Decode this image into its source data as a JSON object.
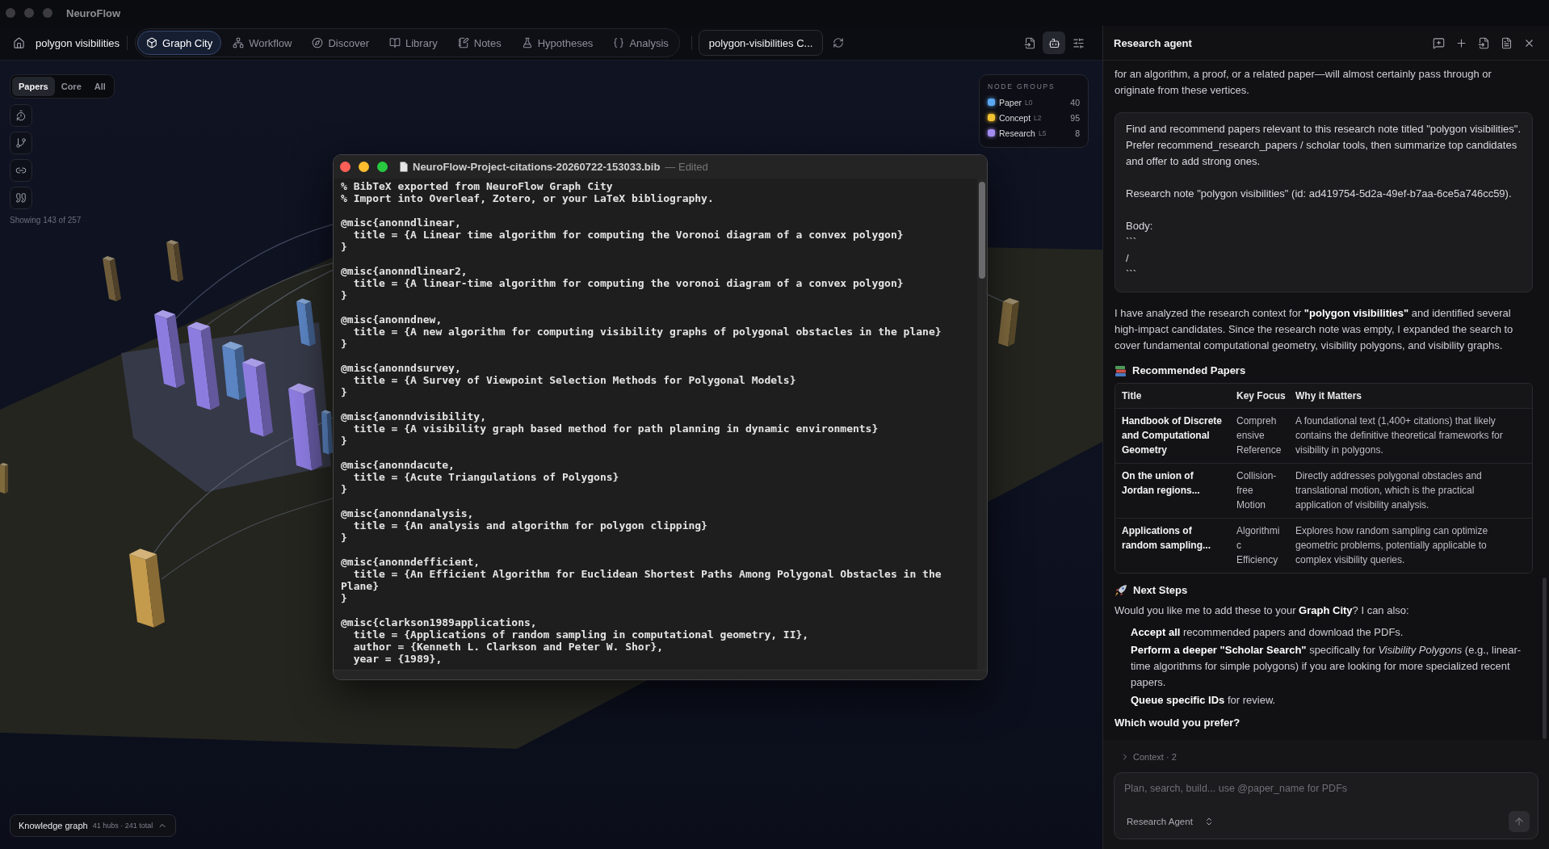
{
  "window": {
    "title": "NeuroFlow"
  },
  "toolbar": {
    "project": "polygon visibilities",
    "nav": [
      {
        "label": "Graph City",
        "selected": true
      },
      {
        "label": "Workflow",
        "selected": false
      },
      {
        "label": "Discover",
        "selected": false
      },
      {
        "label": "Library",
        "selected": false
      },
      {
        "label": "Notes",
        "selected": false
      },
      {
        "label": "Hypotheses",
        "selected": false
      },
      {
        "label": "Analysis",
        "selected": false
      }
    ],
    "document_tab": "polygon-visibilities C...",
    "actions": [
      {
        "selected": false
      },
      {
        "selected": true
      },
      {
        "selected": false
      }
    ]
  },
  "canvas": {
    "view_modes": [
      {
        "label": "Papers",
        "selected": true
      },
      {
        "label": "Core",
        "selected": false
      },
      {
        "label": "All",
        "selected": false
      }
    ],
    "showing": "Showing 143 of 257",
    "node_groups": {
      "title": "NODE GROUPS",
      "items": [
        {
          "label": "Paper",
          "tier": "L0",
          "count": "40",
          "color": "#5aa8f2"
        },
        {
          "label": "Concept",
          "tier": "L2",
          "count": "95",
          "color": "#f2c230"
        },
        {
          "label": "Research",
          "tier": "L5",
          "count": "8",
          "color": "#a48cf0"
        }
      ]
    },
    "footer": {
      "label": "Knowledge graph",
      "meta": "41 hubs · 241 total"
    }
  },
  "editor_window": {
    "title": "NeuroFlow-Project-citations-20260722-153033.bib",
    "status": "— Edited",
    "comments": [
      "% BibTeX exported from NeuroFlow Graph City",
      "% Import into Overleaf, Zotero, or your LaTeX bibliography."
    ],
    "entries": [
      {
        "lines": [
          "@misc{anonndlinear,",
          "  title = {A Linear time algorithm for computing the Voronoi diagram of a convex polygon}",
          "}"
        ]
      },
      {
        "lines": [
          "@misc{anonndlinear2,",
          "  title = {A linear-time algorithm for computing the voronoi diagram of a convex polygon}",
          "}"
        ]
      },
      {
        "lines": [
          "@misc{anonndnew,",
          "  title = {A new algorithm for computing visibility graphs of polygonal obstacles in the plane}",
          "}"
        ]
      },
      {
        "lines": [
          "@misc{anonndsurvey,",
          "  title = {A Survey of Viewpoint Selection Methods for Polygonal Models}",
          "}"
        ]
      },
      {
        "lines": [
          "@misc{anonndvisibility,",
          "  title = {A visibility graph based method for path planning in dynamic environments}",
          "}"
        ]
      },
      {
        "lines": [
          "@misc{anonndacute,",
          "  title = {Acute Triangulations of Polygons}",
          "}"
        ]
      },
      {
        "lines": [
          "@misc{anonndanalysis,",
          "  title = {An analysis and algorithm for polygon clipping}",
          "}"
        ]
      },
      {
        "lines": [
          "@misc{anonndefficient,",
          "  title = {An Efficient Algorithm for Euclidean Shortest Paths Among Polygonal Obstacles in the Plane}",
          "}"
        ]
      },
      {
        "lines": [
          "@misc{clarkson1989applications,",
          "  title = {Applications of random sampling in computational geometry, II},",
          "  author = {Kenneth L. Clarkson and Peter W. Shor},",
          "  year = {1989},"
        ]
      }
    ]
  },
  "agent_panel": {
    "title": "Research agent",
    "intro_tail": "for an algorithm, a proof, or a related paper—will almost certainly pass through or originate from these vertices.",
    "user_message": [
      "Find and recommend papers relevant to this research note titled \"polygon visibilities\". Prefer recommend_research_papers / scholar tools, then summarize top candidates and offer to add strong ones.",
      "Research note \"polygon visibilities\" (id: ad419754-5d2a-49ef-b7aa-6ce5a746cc59).",
      "Body:\n```\n/\n```"
    ],
    "summary": "I have analyzed the research context for **\"polygon visibilities\"** and identified several high-impact candidates. Since the research note was empty, I expanded the search to cover fundamental computational geometry, visibility polygons, and visibility graphs.",
    "papers_heading": "Recommended Papers",
    "table": {
      "columns": [
        "Title",
        "Key Focus",
        "Why it Matters"
      ],
      "rows": [
        [
          "Handbook of Discrete and Computational Geometry",
          "Comprehensive Reference",
          "A foundational text (1,400+ citations) that likely contains the definitive theoretical frameworks for visibility in polygons."
        ],
        [
          "On the union of Jordan regions...",
          "Collision-free Motion",
          "Directly addresses polygonal obstacles and translational motion, which is the practical application of visibility analysis."
        ],
        [
          "Applications of random sampling...",
          "Algorithmic Efficiency",
          "Explores how random sampling can optimize geometric problems, potentially applicable to complex visibility queries."
        ]
      ]
    },
    "next_heading": "Next Steps",
    "next_intro": "Would you like me to add these to your **Graph City**? I can also:",
    "options": [
      "**Accept all** recommended papers and download the PDFs.",
      "**Perform a deeper \"Scholar Search\"** specifically for *Visibility Polygons* (e.g., linear-time algorithms for simple polygons) if you are looking for more specialized recent papers.",
      "**Queue specific IDs** for review."
    ],
    "question": "Which would you prefer?",
    "context": {
      "label": "Context · 2",
      "expanded": false
    },
    "composer": {
      "placeholder": "Plan, search, build... use @paper_name for PDFs",
      "agent": "Research Agent",
      "send_disabled": true
    }
  }
}
